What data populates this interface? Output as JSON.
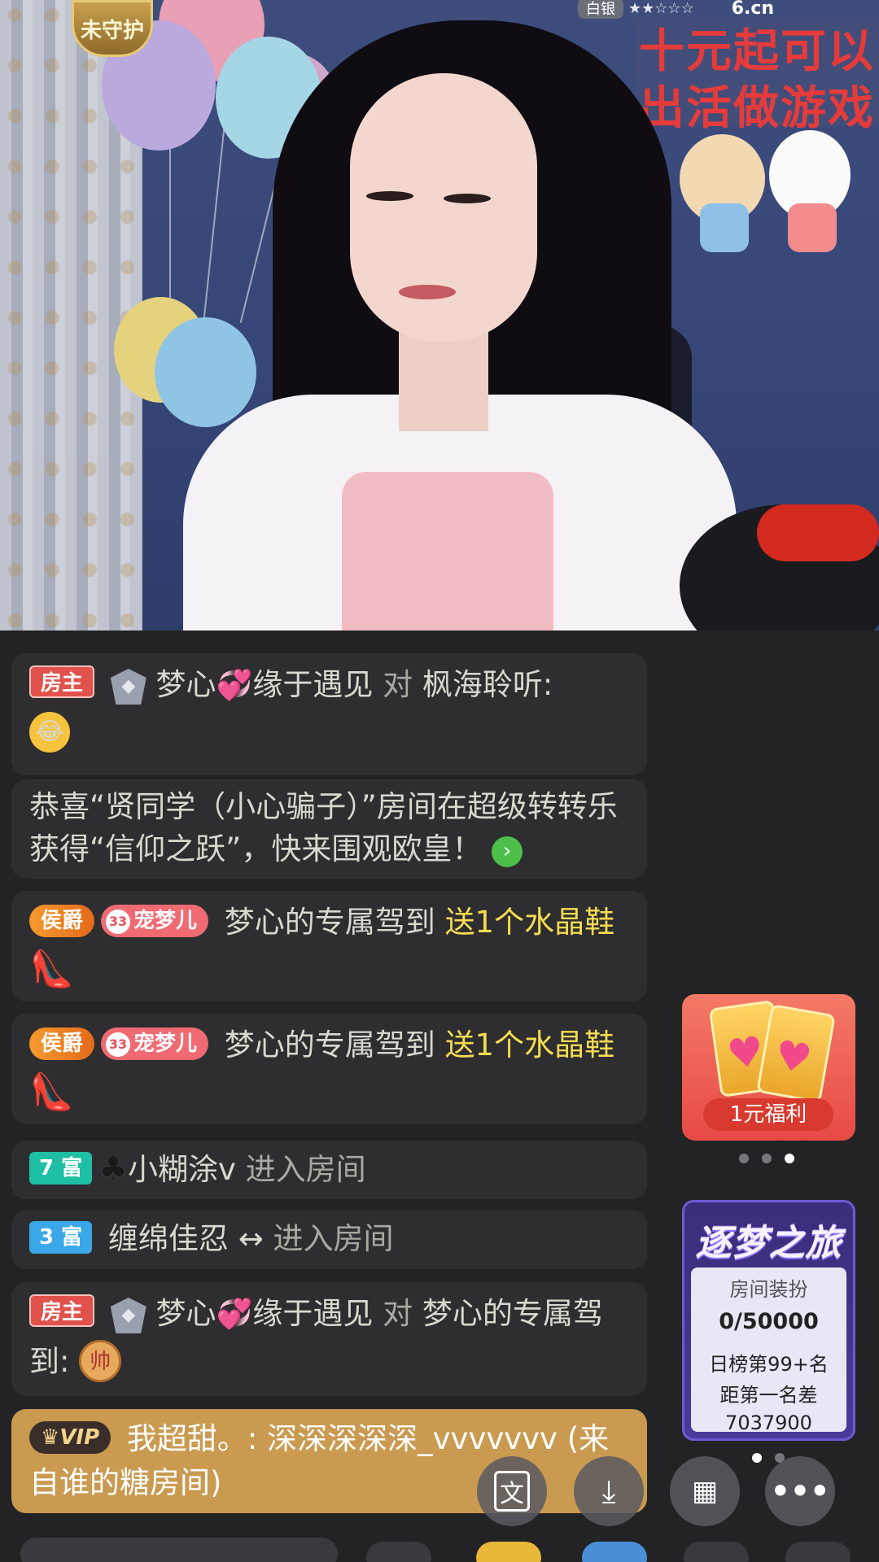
{
  "stream": {
    "guard_badge": "未守护",
    "rank_label": "白银",
    "rank_stars": "★★☆☆☆",
    "site_logo": "6.cn",
    "poster_lines": [
      "十元起可以",
      "出活做游戏"
    ]
  },
  "chat": {
    "messages": [
      {
        "tag": "房主",
        "user": "梦心",
        "user_suffix": "缘于遇见",
        "verb": "对",
        "target": "枫海聆听:",
        "emoji": "😂"
      },
      {
        "system_text": "恭喜“贤同学（小心骗子）”房间在超级转转乐获得“信仰之跃”，快来围观欧皇！"
      },
      {
        "tag": "侯爵",
        "pet_level": "33",
        "pet_tag": "宠梦儿",
        "user": "梦心的专属驾到",
        "gift": "送1个水晶鞋",
        "gift_icon": "crystal-shoe-icon"
      },
      {
        "tag": "侯爵",
        "pet_level": "33",
        "pet_tag": "宠梦儿",
        "user": "梦心的专属驾到",
        "gift": "送1个水晶鞋",
        "gift_icon": "crystal-shoe-icon"
      },
      {
        "tag": "7 富",
        "user": "小糊涂v",
        "action": "进入房间"
      },
      {
        "tag": "3 富",
        "user": "缠绵佳忍",
        "user_suffix": "↔",
        "action": "进入房间"
      },
      {
        "tag": "房主",
        "user": "梦心",
        "user_suffix": "缘于遇见",
        "verb": "对",
        "target": "梦心的专属驾到:",
        "emoji": "帅"
      },
      {
        "tag": "VIP",
        "text": "我超甜。: 深深深深深_vvvvvvv (来自谁的糖房间)"
      }
    ]
  },
  "promo": {
    "label": "1元福利"
  },
  "journey": {
    "title": "逐梦之旅",
    "subtitle": "房间装扮",
    "progress": "0/50000",
    "rank": "日榜第99+名",
    "gap_label": "距第一名差",
    "gap_value": "7037900"
  },
  "colors": {
    "host_tag": "#e0524b",
    "noble_tag": "#f59a2e",
    "rich7_tag": "#1fbfa4",
    "rich3_tag": "#3aa8e8",
    "gift_text": "#f6dc52",
    "vip_bubble": "#c99a50"
  },
  "fabs": [
    "translate-icon",
    "download-icon",
    "apps-grid-icon",
    "more-icon"
  ]
}
